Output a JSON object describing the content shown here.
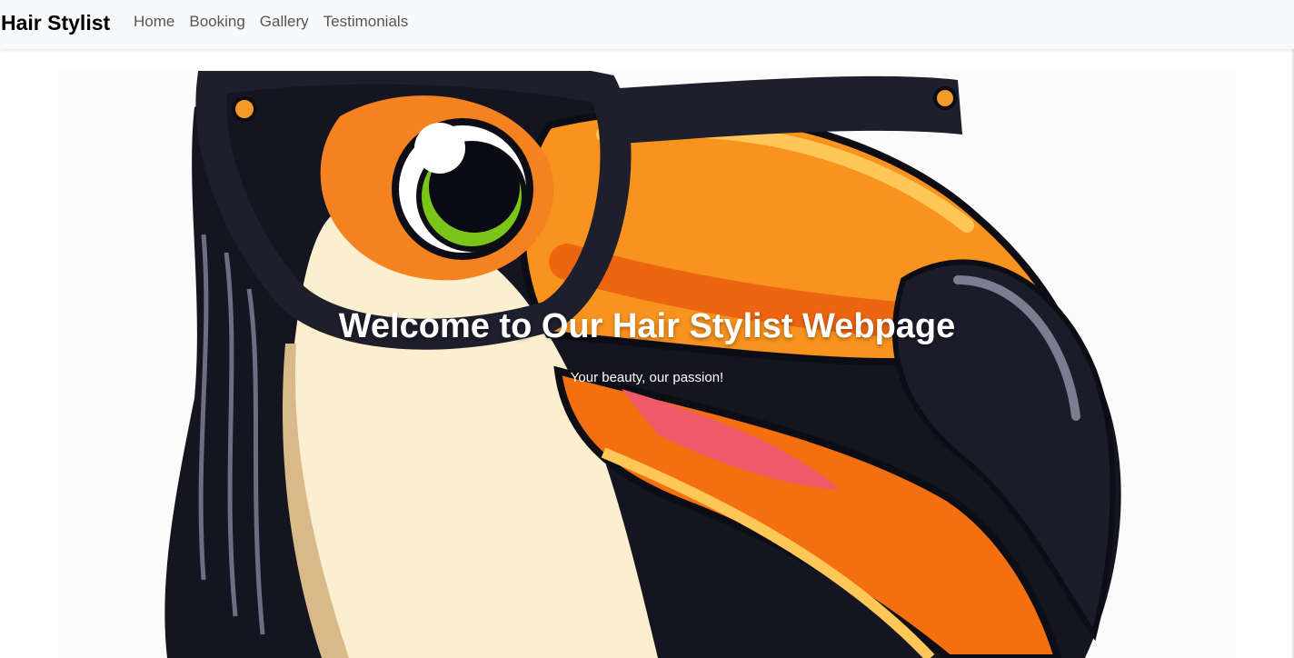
{
  "navbar": {
    "brand": "Hair Stylist",
    "links": [
      {
        "label": "Home"
      },
      {
        "label": "Booking"
      },
      {
        "label": "Gallery"
      },
      {
        "label": "Testimonials"
      }
    ]
  },
  "hero": {
    "title": "Welcome to Our Hair Stylist Webpage",
    "subtitle": "Your beauty, our passion!",
    "image": "toucan-with-glasses-illustration"
  },
  "colors": {
    "navbar_bg": "#f8f9fa",
    "beak_orange": "#f7931e",
    "beak_deep": "#e85a0c",
    "outline": "#0d0d16",
    "throat_cream": "#fbefd0",
    "eye_green": "#7bc418"
  }
}
